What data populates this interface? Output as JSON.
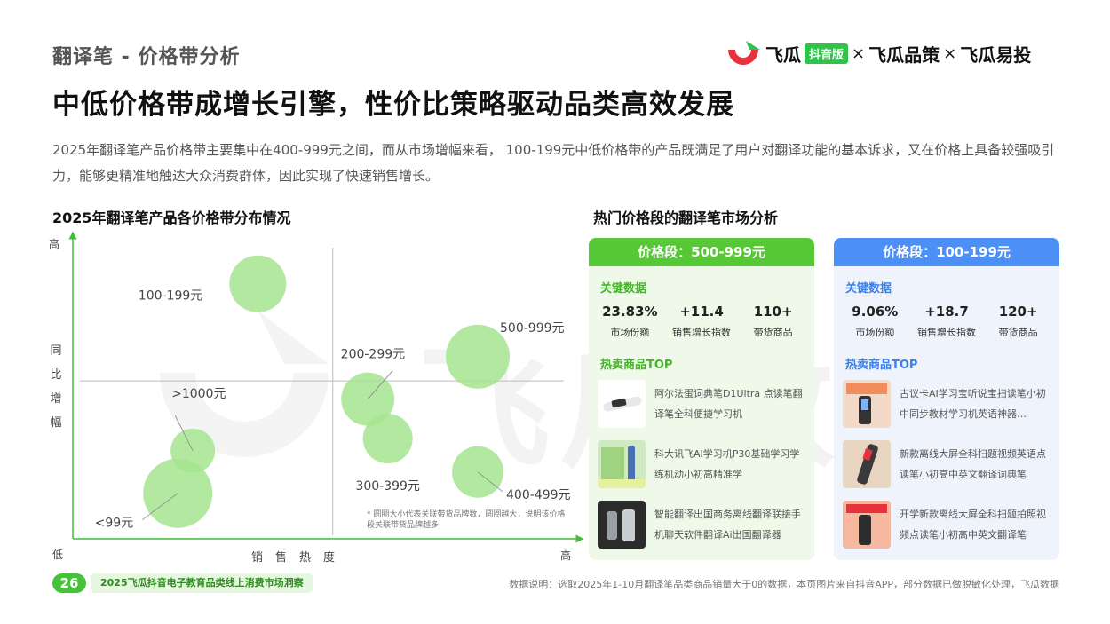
{
  "header": {
    "sub_title": "翻译笔 - 价格带分析",
    "main_title": "中低价格带成增长引擎，性价比策略驱动品类高效发展",
    "brand": {
      "name_1": "飞瓜",
      "badge": "抖音版",
      "sep_1": "×",
      "name_2": "飞瓜品策",
      "sep_2": "×",
      "name_3": "飞瓜易投",
      "colors": {
        "green": "#2fc34a",
        "red": "#e8333c"
      }
    }
  },
  "description": "2025年翻译笔产品价格带主要集中在400-999元之间，而从市场增幅来看， 100-199元中低价格带的产品既满足了用户对翻译功能的基本诉求，又在价格上具备较强吸引力，能够更精准地触达大众消费群体，因此实现了快速销售增长。",
  "watermark": "飞瓜数据",
  "chart_data": {
    "type": "scatter",
    "title": "2025年翻译笔产品各价格带分布情况",
    "xlabel": "销售热度",
    "ylabel": "同比增幅",
    "x_low": "低",
    "x_high": "高",
    "y_high": "高",
    "xlim": [
      0,
      100
    ],
    "ylim": [
      0,
      100
    ],
    "quadrant_center": [
      52,
      52
    ],
    "bubble_color": "#a6e48f",
    "points": [
      {
        "label": "100-199元",
        "x": 37,
        "y": 84,
        "size": 32
      },
      {
        "label": "500-999元",
        "x": 81,
        "y": 60,
        "size": 36
      },
      {
        "label": "200-299元",
        "x": 59,
        "y": 46,
        "size": 30
      },
      {
        "label": "300-399元",
        "x": 63,
        "y": 33,
        "size": 28
      },
      {
        "label": ">1000元",
        "x": 24,
        "y": 29,
        "size": 25
      },
      {
        "label": "400-499元",
        "x": 81,
        "y": 22,
        "size": 29
      },
      {
        "label": "<99元",
        "x": 21,
        "y": 15,
        "size": 39
      }
    ],
    "note": "* 圆圈大小代表关联带货品牌数，圆圈越大，说明该价格段关联带货品牌越多"
  },
  "market": {
    "title": "热门价格段的翻译笔市场分析",
    "key_data_label": "关键数据",
    "top_label": "热卖商品TOP",
    "panels": [
      {
        "head": "价格段：500-999元",
        "accent": "#56c735",
        "stats": [
          {
            "value": "23.83%",
            "label": "市场份额"
          },
          {
            "value": "+11.4",
            "label": "销售增长指数"
          },
          {
            "value": "110+",
            "label": "带货商品"
          }
        ],
        "products": [
          "阿尔法蛋词典笔D1Ultra 点读笔翻译笔全科便捷学习机",
          "科大讯飞AI学习机P30基础学习学练机动小初高精准学",
          "智能翻译出国商务离线翻译联接手机聊天软件翻译Ai出国翻译器"
        ]
      },
      {
        "head": "价格段：100-199元",
        "accent": "#4c8ff6",
        "stats": [
          {
            "value": "9.06%",
            "label": "市场份额"
          },
          {
            "value": "+18.7",
            "label": "销售增长指数"
          },
          {
            "value": "120+",
            "label": "带货商品"
          }
        ],
        "products": [
          "古议卡AI学习宝听说宝扫读笔小初中同步教材学习机英语神器…",
          "新款离线大屏全科扫题视频英语点读笔小初高中英文翻译词典笔",
          "开学新款离线大屏全科扫题拍照视频点读笔小初高中英文翻译笔"
        ]
      }
    ]
  },
  "footer": {
    "page_number": "26",
    "report_name": "2025飞瓜抖音电子教育品类线上消费市场洞察",
    "source": "数据说明：选取2025年1-10月翻译笔品类商品销量大于0的数据，本页图片来自抖音APP，部分数据已做脱敏化处理，飞瓜数据"
  }
}
